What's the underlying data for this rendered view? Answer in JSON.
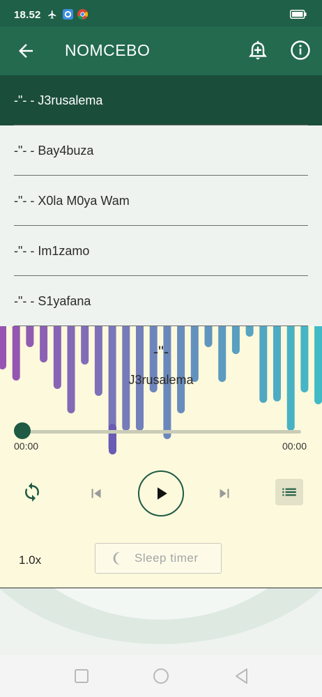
{
  "status_bar": {
    "time": "18.52",
    "icons": [
      "airplane-icon",
      "app-icon",
      "chrome-icon"
    ],
    "battery_icon": "battery-icon"
  },
  "app_bar": {
    "title": "NOMCEBO",
    "back_icon": "arrow-back-icon",
    "alarm_icon": "alarm-add-icon",
    "info_icon": "info-icon"
  },
  "playlist": [
    {
      "label": "-\"- - J3rusalema",
      "active": true
    },
    {
      "label": "-\"- - Bay4buza",
      "active": false
    },
    {
      "label": "-\"- - X0la M0ya Wam",
      "active": false
    },
    {
      "label": "-\"- - Im1zamo",
      "active": false
    },
    {
      "label": "-\"- - S1yafana",
      "active": false
    }
  ],
  "player": {
    "artist": "-\"-",
    "song": "J3rusalema",
    "current_time": "00:00",
    "total_time": "00:00",
    "progress": 0,
    "speed": "1.0x",
    "sleep_timer_label": "Sleep timer"
  },
  "colors": {
    "header": "#236a4f",
    "status_bar": "#1f6048",
    "active_row": "#1b4d3b",
    "player_bg": "#fdf9dc",
    "accent": "#1e5a44",
    "visualizer_start": "#8e44ad",
    "visualizer_end": "#1ad1c9"
  }
}
